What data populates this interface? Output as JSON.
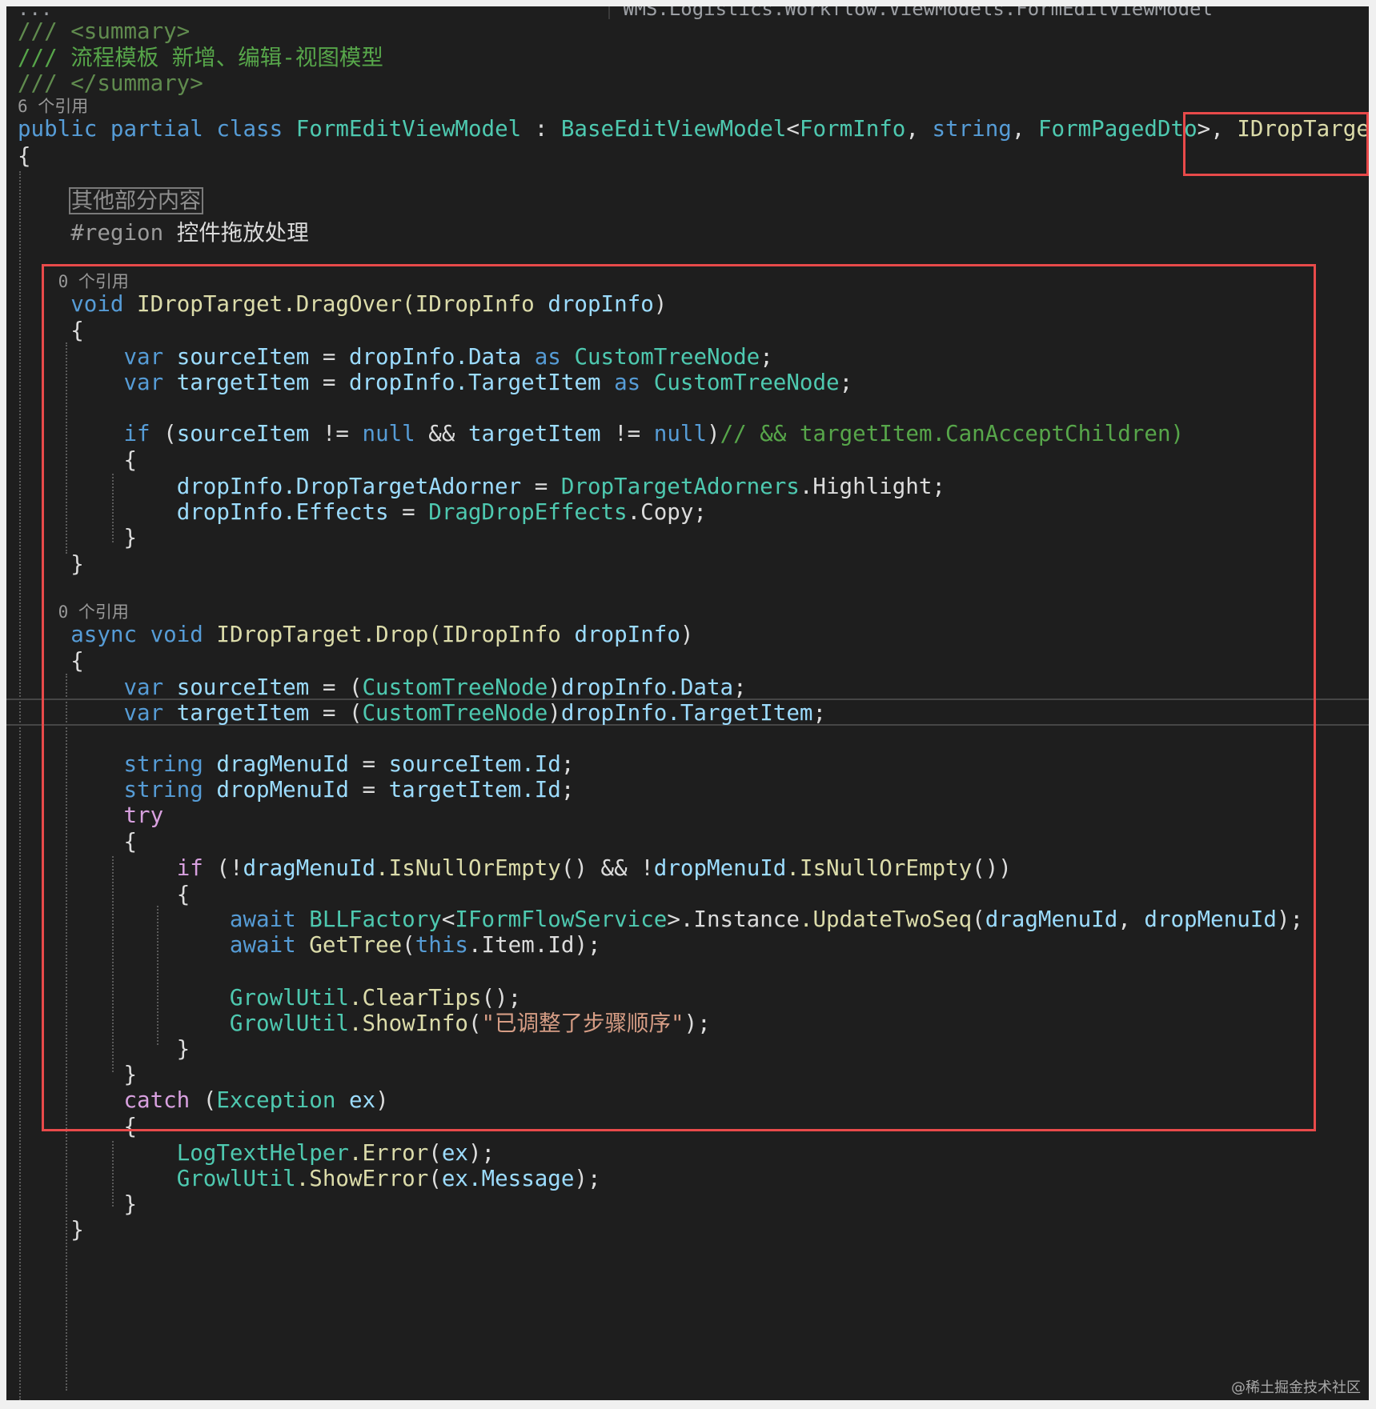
{
  "header": {
    "left_fragment": "...",
    "right_fragment": "WMS.Logistics.Workflow.ViewModels.FormEditViewModel"
  },
  "code": {
    "summary_open": "/// <summary>",
    "summary_text": "/// 流程模板 新增、编辑-视图模型",
    "summary_close": "/// </summary>",
    "class_refs": "6 个引用",
    "class_decl": {
      "kw_public": "public",
      "kw_partial": "partial",
      "kw_class": "class",
      "name": "FormEditViewModel",
      "colon": " : ",
      "base": "BaseEditViewModel",
      "lt": "<",
      "arg1": "FormInfo",
      "comma1": ", ",
      "arg2": "string",
      "comma2": ", ",
      "arg3": "FormPagedDto",
      "gt": ">, ",
      "iface": "IDropTarget"
    },
    "brace_open": "{",
    "collapsed_region": "其他部分内容",
    "region_kw": "#region",
    "region_name": "控件拖放处理",
    "dragover": {
      "refs": "0 个引用",
      "kw_void": "void",
      "iface": "IDropTarget",
      "method": ".DragOver(",
      "param_type": "IDropInfo",
      "param": "dropInfo",
      "close": ")",
      "kw_var": "var",
      "source_item": "sourceItem",
      "target_item": "targetItem",
      "assign": " = ",
      "drop_info": "dropInfo",
      "data_member": ".Data",
      "target_member": ".TargetItem",
      "kw_as": "as",
      "node_type": "CustomTreeNode",
      "semicolon": ";",
      "kw_if": "if",
      "neq_null": " != ",
      "kw_null": "null",
      "and": " && ",
      "comment": "// && targetItem.CanAcceptChildren)",
      "adorner_member": ".DropTargetAdorner",
      "adorners_type": "DropTargetAdorners",
      "highlight": ".Highlight",
      "effects_member": ".Effects",
      "effects_type": "DragDropEffects",
      "copy": ".Copy"
    },
    "drop": {
      "refs": "0 个引用",
      "kw_async": "async",
      "kw_void": "void",
      "iface": "IDropTarget",
      "method": ".Drop(",
      "param_type": "IDropInfo",
      "param": "dropInfo",
      "close": ")",
      "kw_var": "var",
      "kw_string": "string",
      "drag_menu_id": "dragMenuId",
      "drop_menu_id": "dropMenuId",
      "id_member": ".Id",
      "kw_try": "try",
      "not": "!",
      "is_null_or_empty": ".IsNullOrEmpty",
      "call_empty": "()",
      "kw_await": "await",
      "factory": "BLLFactory",
      "service": "IFormFlowService",
      "instance": ".Instance",
      "update": ".UpdateTwoSeq",
      "get_tree": "GetTree",
      "kw_this": "this",
      "item_member": ".Item",
      "growl": "GrowlUtil",
      "clear_tips": ".ClearTips",
      "show_info": ".ShowInfo",
      "info_message": "\"已调整了步骤顺序\"",
      "kw_catch": "catch",
      "exception_type": "Exception",
      "ex": "ex",
      "log_helper": "LogTextHelper",
      "error_method": ".Error",
      "show_error": ".ShowError",
      "message_member": ".Message"
    }
  },
  "watermark": "@稀土掘金技术社区",
  "colors": {
    "background": "#1e1e1e",
    "keyword": "#569cd6",
    "control_keyword": "#d8a0df",
    "type": "#4ec9b0",
    "string": "#d69d85",
    "comment": "#57a64a",
    "variable": "#9cdcfe",
    "method": "#dcdcaa",
    "highlight_box": "#e84a4a"
  }
}
